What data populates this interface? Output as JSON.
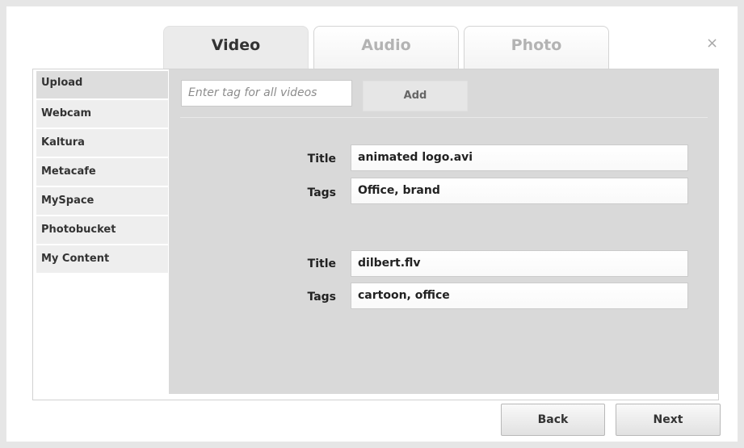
{
  "tabs": [
    {
      "label": "Video"
    },
    {
      "label": "Audio"
    },
    {
      "label": "Photo"
    }
  ],
  "close_glyph": "×",
  "sidebar": {
    "items": [
      {
        "label": "Upload"
      },
      {
        "label": "Webcam"
      },
      {
        "label": "Kaltura"
      },
      {
        "label": "Metacafe"
      },
      {
        "label": "MySpace"
      },
      {
        "label": "Photobucket"
      },
      {
        "label": "My Content"
      }
    ]
  },
  "toolbar": {
    "tag_placeholder": "Enter tag for all videos",
    "add_label": "Add"
  },
  "labels": {
    "title": "Title",
    "tags": "Tags"
  },
  "videos": [
    {
      "title": "animated logo.avi",
      "tags": "Office, brand"
    },
    {
      "title": "dilbert.flv",
      "tags": "cartoon, office"
    }
  ],
  "buttons": {
    "back": "Back",
    "next": "Next"
  }
}
